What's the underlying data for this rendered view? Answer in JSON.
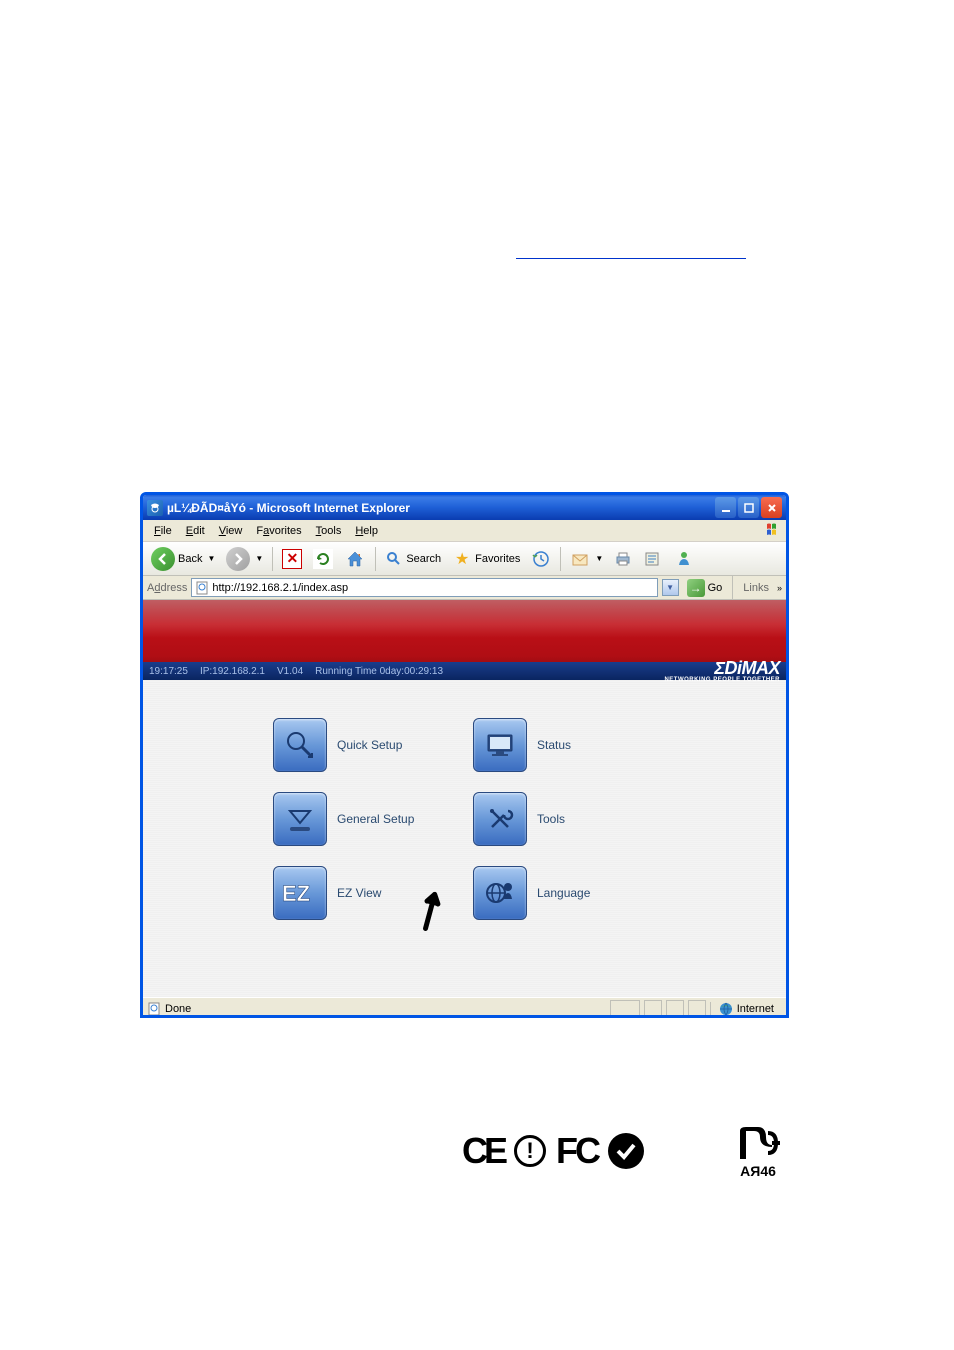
{
  "window": {
    "title": "µL¼ÐÃD¤åYó - Microsoft Internet Explorer"
  },
  "menubar": {
    "file": "File",
    "edit": "Edit",
    "view": "View",
    "favorites": "Favorites",
    "tools": "Tools",
    "help": "Help"
  },
  "toolbar": {
    "back": "Back",
    "search": "Search",
    "favorites": "Favorites"
  },
  "addressbar": {
    "label": "Address",
    "url": "http://192.168.2.1/index.asp",
    "go": "Go",
    "links": "Links"
  },
  "banner": {
    "time": "19:17:25",
    "ip": "IP:192.168.2.1",
    "version": "V1.04",
    "running": "Running Time 0day:00:29:13",
    "brand": "ΣDiMAX",
    "tagline": "NETWORKING PEOPLE TOGETHER"
  },
  "tiles": {
    "quick_setup": "Quick Setup",
    "status": "Status",
    "general_setup": "General Setup",
    "tools": "Tools",
    "ez_view": "EZ View",
    "language": "Language"
  },
  "statusbar": {
    "done": "Done",
    "zone": "Internet"
  },
  "certs": {
    "ce": "CE",
    "fc": "FC",
    "pct_code": "AЯ46"
  }
}
